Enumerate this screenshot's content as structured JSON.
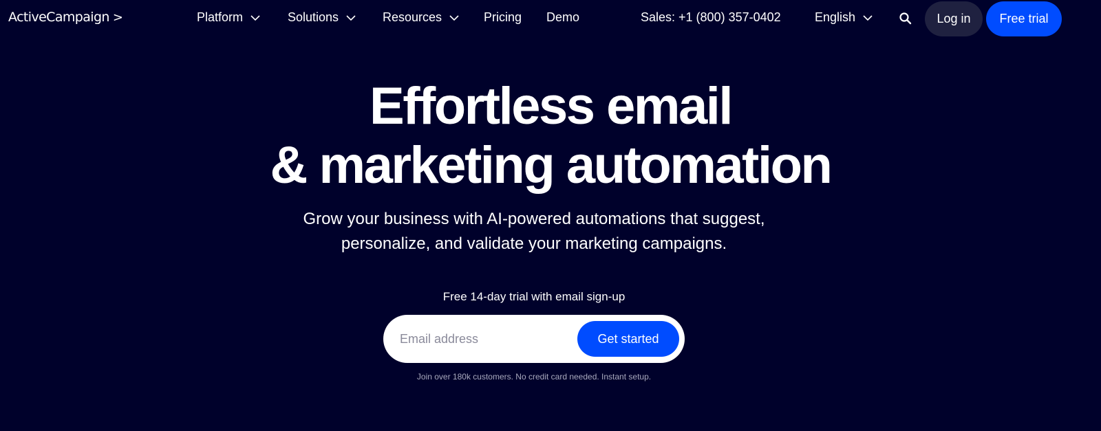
{
  "colors": {
    "background": "#00012b",
    "accent": "#004cff",
    "login_bg": "#1f2140",
    "fineprint": "#a8a9bd"
  },
  "nav": {
    "logo": "ActiveCampaign",
    "logo_icon": "chevron-right-icon",
    "items": [
      {
        "label": "Platform",
        "has_dropdown": true
      },
      {
        "label": "Solutions",
        "has_dropdown": true
      },
      {
        "label": "Resources",
        "has_dropdown": true
      },
      {
        "label": "Pricing",
        "has_dropdown": false
      },
      {
        "label": "Demo",
        "has_dropdown": false
      }
    ],
    "sales": "Sales: +1 (800) 357-0402",
    "language": "English",
    "search_icon": "search-icon",
    "login": "Log in",
    "free_trial": "Free trial"
  },
  "hero": {
    "title_line1": "Effortless email",
    "title_line2": "& marketing automation",
    "subtitle_line1": "Grow your business with AI-powered automations that suggest,",
    "subtitle_line2": "personalize, and validate your marketing campaigns.",
    "trial_label": "Free 14-day trial with email sign-up",
    "email_placeholder": "Email address",
    "email_value": "",
    "cta": "Get started",
    "fineprint": "Join over 180k customers. No credit card needed. Instant setup."
  }
}
